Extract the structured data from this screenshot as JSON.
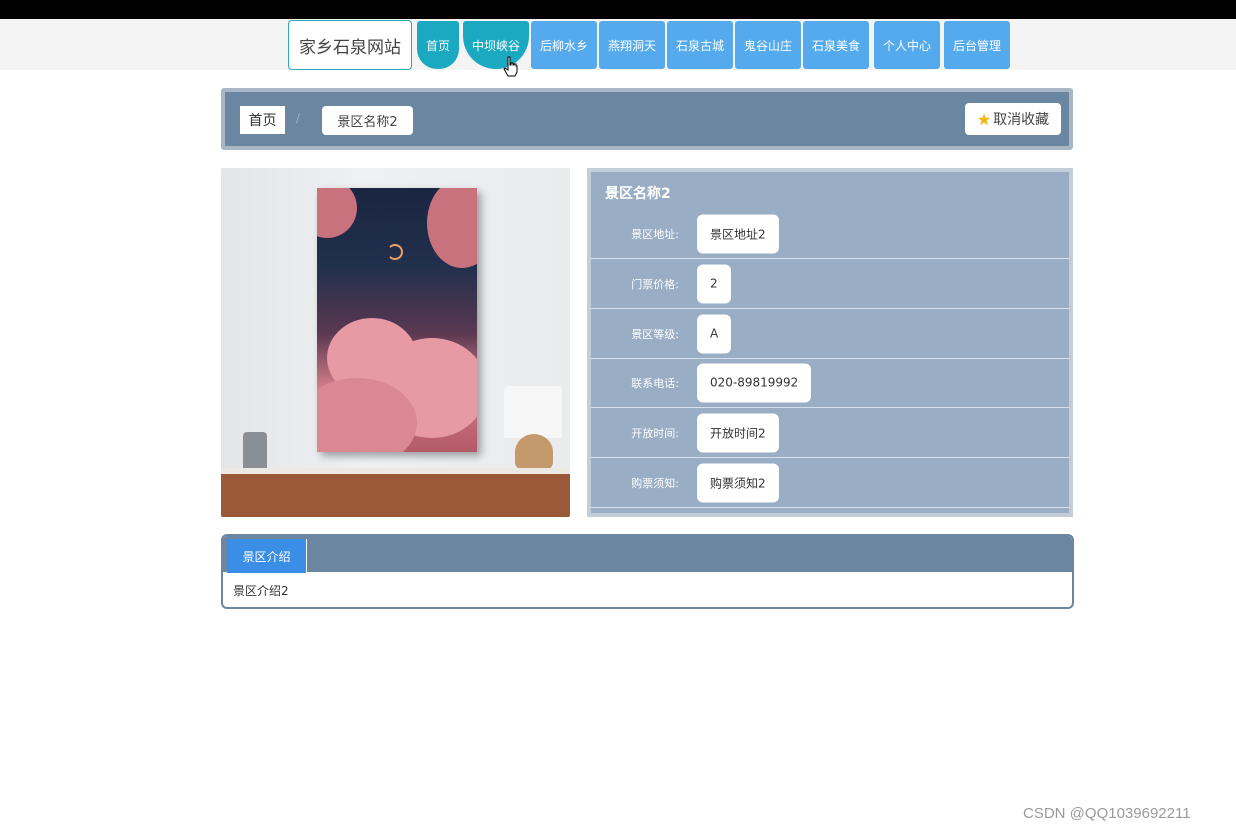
{
  "header": {
    "site_title": "家乡石泉网站",
    "nav": [
      {
        "label": "首页"
      },
      {
        "label": "中坝峡谷"
      },
      {
        "label": "后柳水乡"
      },
      {
        "label": "燕翔洞天"
      },
      {
        "label": "石泉古城"
      },
      {
        "label": "鬼谷山庄"
      },
      {
        "label": "石泉美食"
      },
      {
        "label": "个人中心"
      },
      {
        "label": "后台管理"
      }
    ]
  },
  "breadcrumb": {
    "home": "首页",
    "separator": "/",
    "current": "景区名称2",
    "favorite_label": "取消收藏"
  },
  "detail": {
    "name": "景区名称2",
    "rows": [
      {
        "label": "景区地址:",
        "value": "景区地址2"
      },
      {
        "label": "门票价格:",
        "value": "2"
      },
      {
        "label": "景区等级:",
        "value": "A"
      },
      {
        "label": "联系电话:",
        "value": "020-89819992"
      },
      {
        "label": "开放时间:",
        "value": "开放时间2"
      },
      {
        "label": "购票须知:",
        "value": "购票须知2"
      }
    ]
  },
  "intro": {
    "tab_label": "景区介绍",
    "content": "景区介绍2"
  },
  "watermark": "CSDN @QQ1039692211",
  "colors": {
    "nav_blue": "#55aaee",
    "nav_active": "#1aa9c0",
    "panel_steel": "#6a86a1",
    "info_panel": "#99aec4",
    "tab_blue": "#3a8ee6"
  }
}
